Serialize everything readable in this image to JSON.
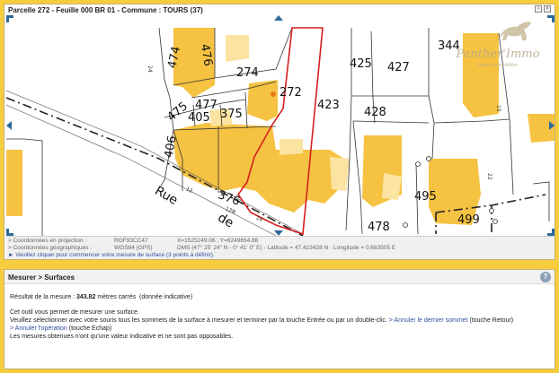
{
  "cadastre": {
    "title": "Parcelle 272 - Feuille 000 BR 01 - Commune : TOURS (37)",
    "window_icons": [
      "restore-icon",
      "close-icon"
    ],
    "parcels": [
      "474",
      "476",
      "274",
      "272",
      "425",
      "427",
      "344",
      "475",
      "477",
      "405",
      "375",
      "423",
      "428",
      "406",
      "376",
      "495",
      "499",
      "478"
    ],
    "street_name_parts": [
      "Rue",
      "de"
    ],
    "small_numbers": [
      "24",
      "15",
      "12",
      "12B",
      "14",
      "22"
    ],
    "colors": {
      "building": "#f5c242",
      "building_light": "#fbe3a1",
      "selection": "#d42020",
      "marker": "#e87818",
      "nav": "#2c6a9a"
    }
  },
  "watermark": {
    "name": "Panther'Immo",
    "tagline": "Agence Immobilière"
  },
  "coordinates": {
    "projection": {
      "label": "> Coordonnées en projection :",
      "system": "RGF93CC47",
      "value": "X=1525249.06 ; Y=6249654.86"
    },
    "geographic": {
      "label": "> Coordonnées géographiques :",
      "system": "WGS84 (GPS)",
      "value": "DMS (47° 25' 24\" N - 0° 41' 0\" E) - Latitude = 47.423428 N - Longitude = 0.683505 E"
    },
    "instruction": "► Veuillez cliquer pour commencer votre mesure de surface (3 points à définir)."
  },
  "measure": {
    "header": "Mesurer > Surfaces",
    "result_label": "Résultat de la mesure :",
    "result_value": "343.82",
    "result_unit": "mètres carrés",
    "result_note": "(donnée indicative)",
    "line1": "Cet outil vous permet de mesurer une surface.",
    "line2": "Veuillez sélectionner avec votre souris tous les sommets de la surface à mesurer et terminer par la touche Entrée ou par un double-clic.",
    "undo_last_link": "> Annuler le dernier sommet",
    "undo_last_key": "(touche Retour)",
    "cancel_link": "> Annuler l'opération",
    "cancel_key": "(touche Echap)",
    "line4": "Les mesures obtenues n'ont qu'une valeur indicative et ne sont pas opposables."
  }
}
